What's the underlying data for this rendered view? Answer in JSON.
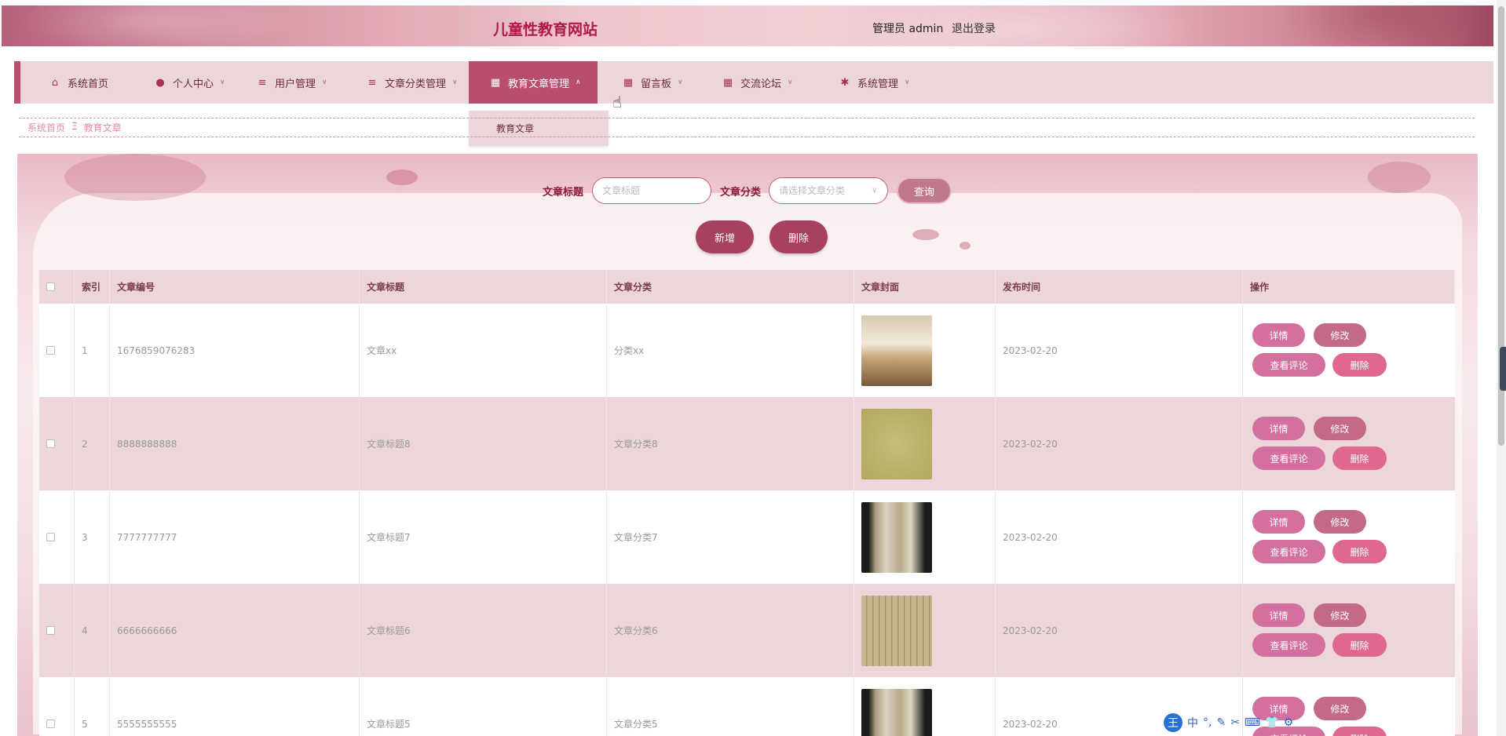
{
  "header": {
    "site_title": "儿童性教育网站",
    "user_label": "管理员 admin",
    "logout": "退出登录"
  },
  "nav": {
    "items": [
      {
        "label": "系统首页",
        "icon": "home-icon"
      },
      {
        "label": "个人中心",
        "icon": "user-icon"
      },
      {
        "label": "用户管理",
        "icon": "list-icon"
      },
      {
        "label": "文章分类管理",
        "icon": "list-icon"
      },
      {
        "label": "教育文章管理",
        "icon": "grid-icon",
        "active": true
      },
      {
        "label": "留言板",
        "icon": "grid-icon"
      },
      {
        "label": "交流论坛",
        "icon": "grid-icon"
      },
      {
        "label": "系统管理",
        "icon": "settings-icon"
      }
    ],
    "dropdown_item": "教育文章"
  },
  "breadcrumb": {
    "home": "系统首页",
    "separator": "Ξ",
    "current": "教育文章"
  },
  "search": {
    "title_label": "文章标题",
    "title_placeholder": "文章标题",
    "category_label": "文章分类",
    "category_placeholder": "请选择文章分类",
    "query_button": "查询"
  },
  "actions": {
    "add": "新增",
    "delete": "删除"
  },
  "table": {
    "columns": [
      "索引",
      "文章编号",
      "文章标题",
      "文章分类",
      "文章封面",
      "发布时间",
      "操作"
    ],
    "rows": [
      {
        "index": "1",
        "code": "1676859076283",
        "title": "文章xx",
        "category": "分类xx",
        "date": "2023-02-20"
      },
      {
        "index": "2",
        "code": "8888888888",
        "title": "文章标题8",
        "category": "文章分类8",
        "date": "2023-02-20"
      },
      {
        "index": "3",
        "code": "7777777777",
        "title": "文章标题7",
        "category": "文章分类7",
        "date": "2023-02-20"
      },
      {
        "index": "4",
        "code": "6666666666",
        "title": "文章标题6",
        "category": "文章分类6",
        "date": "2023-02-20"
      },
      {
        "index": "5",
        "code": "5555555555",
        "title": "文章标题5",
        "category": "文章分类5",
        "date": "2023-02-20"
      }
    ],
    "op_labels": {
      "detail": "详情",
      "edit": "修改",
      "comments": "查看评论",
      "delete": "删除"
    }
  },
  "ime": {
    "logo": "王",
    "mode": "中"
  },
  "colors": {
    "accent": "#b84d6d",
    "nav_bg": "#ecd6da",
    "title": "#b0184a",
    "button_pink": "#d470a0"
  }
}
